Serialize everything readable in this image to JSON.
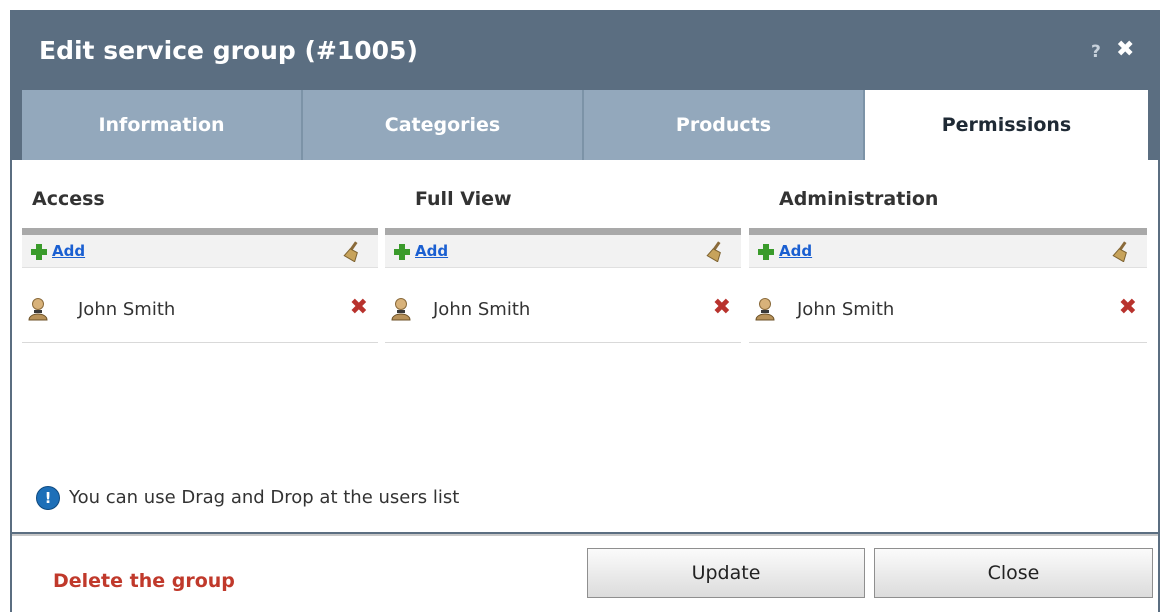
{
  "dialog": {
    "title": "Edit service group (#1005)",
    "help_label": "?",
    "close_glyph": "✖"
  },
  "tabs": [
    {
      "label": "Information"
    },
    {
      "label": "Categories"
    },
    {
      "label": "Products"
    },
    {
      "label": "Permissions",
      "active": true
    }
  ],
  "columns": [
    {
      "heading": "Access",
      "add_label": "Add",
      "users": [
        {
          "name": "John Smith"
        }
      ]
    },
    {
      "heading": "Full View",
      "add_label": "Add",
      "users": [
        {
          "name": "John Smith"
        }
      ]
    },
    {
      "heading": "Administration",
      "add_label": "Add",
      "users": [
        {
          "name": "John Smith"
        }
      ]
    }
  ],
  "hint": {
    "icon_glyph": "!",
    "text": "You can use Drag and Drop at the users list"
  },
  "footer": {
    "delete_label": "Delete the group",
    "update_label": "Update",
    "close_label": "Close"
  },
  "icons": {
    "add": "plus-icon",
    "clear": "broom-icon",
    "user": "user-icon",
    "remove": "delete-x-icon",
    "info": "info-icon"
  },
  "colors": {
    "titlebar": "#5b6e81",
    "tab_inactive": "#93a8bc",
    "delete_text": "#c0392b",
    "add_plus": "#3a9b2b",
    "link": "#1a5fd1"
  }
}
